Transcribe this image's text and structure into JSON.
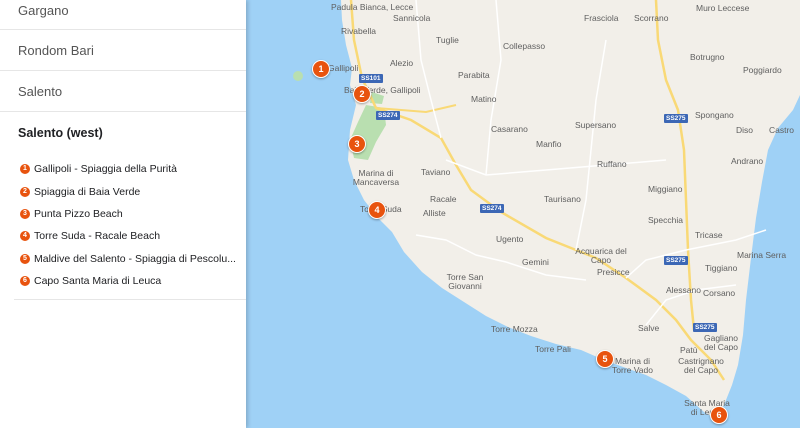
{
  "sidebar": {
    "sections": [
      "Gargano",
      "Rondom Bari",
      "Salento"
    ],
    "active_section": "Salento (west)",
    "places": [
      {
        "num": "1",
        "label": "Gallipoli - Spiaggia della Purità"
      },
      {
        "num": "2",
        "label": "Spiaggia di Baia Verde"
      },
      {
        "num": "3",
        "label": "Punta Pizzo Beach"
      },
      {
        "num": "4",
        "label": "Torre Suda - Racale Beach"
      },
      {
        "num": "5",
        "label": "Maldive del Salento - Spiaggia di Pescolu..."
      },
      {
        "num": "6",
        "label": "Capo Santa Maria di Leuca"
      }
    ]
  },
  "map": {
    "colors": {
      "sea": "#9fd1f6",
      "land": "#f2efe9",
      "park": "#b9dfb0",
      "road": "#f9d976",
      "marker": "#e8530e",
      "shield": "#3c67b5"
    },
    "towns": [
      "Padula Bianca, Lecce",
      "Sannicola",
      "Rivabella",
      "Gallipoli",
      "Alezio",
      "Baia Verde, Gallipoli",
      "Tuglie",
      "Collepasso",
      "Frasciola",
      "Scorrano",
      "Muro Leccese",
      "Botrugno",
      "Poggiardo",
      "Parabita",
      "Matino",
      "Casarano",
      "Supersano",
      "Spongano",
      "Diso",
      "Castro",
      "Manfio",
      "Ruffano",
      "Andrano",
      "Taviano",
      "Marina di Mancaversa",
      "Miggiano",
      "Racale",
      "Torre Suda",
      "Alliste",
      "Taurisano",
      "Specchia",
      "Tricase",
      "Ugento",
      "Acquarica del Capo",
      "Marina Serra",
      "Gemini",
      "Presicce",
      "Tiggiano",
      "Torre San Giovanni",
      "Alessano",
      "Corsano",
      "Torre Mozza",
      "Salve",
      "Torre Pali",
      "Gagliano del Capo",
      "Marina di Torre Vado",
      "Patù",
      "Castrignano del Capo",
      "Santa Maria di Leuca"
    ],
    "road_shields": [
      "SS101",
      "SS274",
      "SS274",
      "SS275",
      "SS275",
      "SS275"
    ],
    "markers": [
      "1",
      "2",
      "3",
      "4",
      "5",
      "6"
    ]
  }
}
